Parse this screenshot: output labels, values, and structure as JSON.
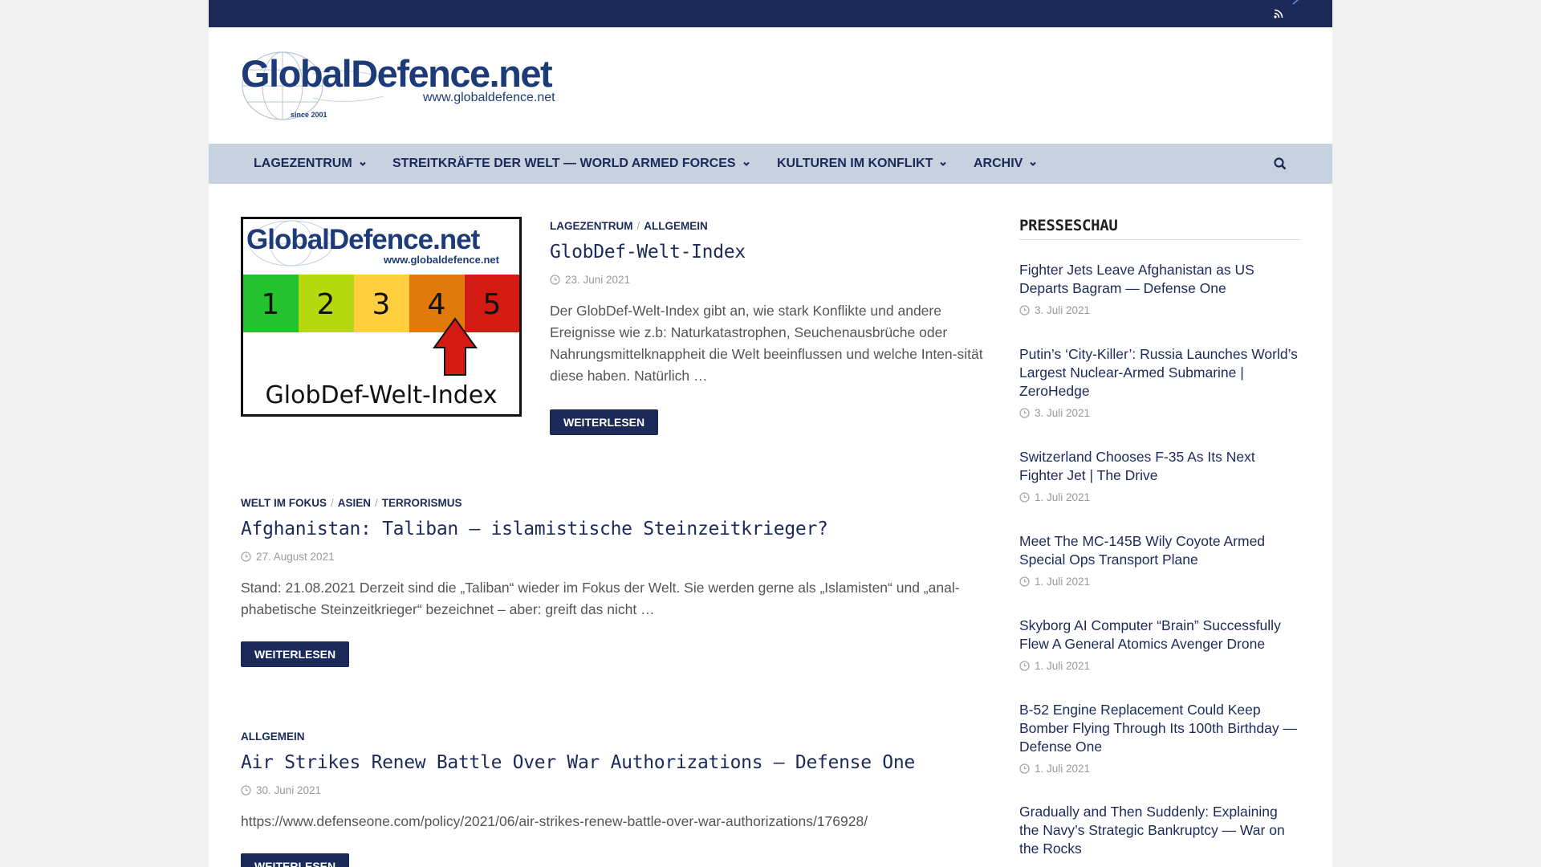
{
  "site": {
    "logo_text": "GlobalDefence.net",
    "logo_url": "www.globaldefence.net",
    "logo_since": "since 2001"
  },
  "nav": {
    "items": [
      {
        "label": "Lagezentrum"
      },
      {
        "label": "Streitkräfte der Welt — World Armed Forces"
      },
      {
        "label": "Kulturen im Konflikt"
      },
      {
        "label": "Archiv"
      }
    ]
  },
  "articles": [
    {
      "categories": [
        "Lagezentrum",
        "Allgemein"
      ],
      "title": "GlobDef-Welt-Index",
      "date": "23. Juni 2021",
      "excerpt": "Der GlobDef-Welt-Index gibt an, wie stark Konflikte und andere Ereignisse wie z.b: Naturkatastrophen, Seuchenausbrüche oder Nahrungsmittelknappheit die Welt beeinflussen und welche Inten-sität diese haben. Natürlich …",
      "button": "Weiterlesen",
      "thumb": {
        "logo_text": "GlobalDefence.net",
        "logo_url": "www.globaldefence.net",
        "levels": [
          "1",
          "2",
          "3",
          "4",
          "5"
        ],
        "caption": "GlobDef-Welt-Index"
      }
    },
    {
      "categories": [
        "Welt im Fokus",
        "Asien",
        "Terrorismus"
      ],
      "title": "Afghanistan: Taliban – islamistische Steinzeitkrieger?",
      "date": "27. August 2021",
      "excerpt": "Stand: 21.08.2021 Derzeit sind die „Taliban“ wieder im Fokus der Welt. Sie werden gerne als „Islamisten“ und „anal-phabetische Steinzeitkrieger“ bezeichnet – aber: greift das nicht …",
      "button": "Weiterlesen"
    },
    {
      "categories": [
        "Allgemein"
      ],
      "title": "Air Strikes Renew Battle Over War Authorizations — Defense One",
      "date": "30. Juni 2021",
      "excerpt": "https://www.defenseone.com/policy/2021/06/air-strikes-renew-battle-over-war-authorizations/176928/",
      "button": "Weiterlesen"
    }
  ],
  "sidebar": {
    "title": "Presseschau",
    "items": [
      {
        "title": "Fighter Jets Leave Afghanistan as US Departs Bagram — Defense One",
        "date": "3. Juli 2021"
      },
      {
        "title": "Putin’s ‘City-Killer’: Russia Launches World’s Largest Nuclear-Armed Submarine | ZeroHedge",
        "date": "3. Juli 2021"
      },
      {
        "title": "Switzerland Chooses F-35 As Its Next Fighter Jet | The Drive",
        "date": "1. Juli 2021"
      },
      {
        "title": "Meet The MC-145B Wily Coyote Armed Special Ops Transport Plane",
        "date": "1. Juli 2021"
      },
      {
        "title": "Skyborg AI Computer “Brain” Successfully Flew A General Atomics Avenger Drone",
        "date": "1. Juli 2021"
      },
      {
        "title": "B-52 Engine Replacement Could Keep Bomber Flying Through Its 100th Birthday — Defense One",
        "date": "1. Juli 2021"
      },
      {
        "title": "Gradually and Then Suddenly: Explaining the Navy’s Strategic Bankruptcy — War on the Rocks",
        "date": ""
      }
    ]
  },
  "colors": {
    "navy": "#1c2a5a",
    "nav_bg": "#c6d2e0",
    "level_1": "#22c32e",
    "level_2": "#b5d80f",
    "level_3": "#ffcf40",
    "level_4": "#e07a0a",
    "level_5": "#d41b13"
  }
}
